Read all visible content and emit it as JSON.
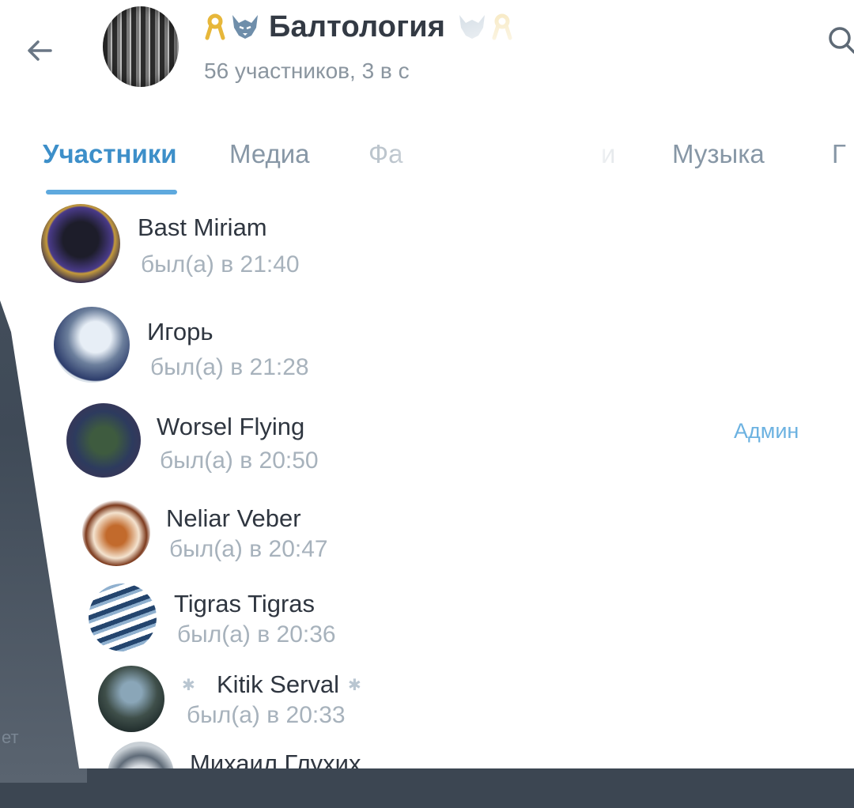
{
  "header": {
    "back_icon": "arrow-left-icon",
    "title": "Балтология",
    "title_prefix_icons": [
      "ribbon-icon",
      "wolf-icon"
    ],
    "title_suffix_icons": [
      "wolf-icon",
      "ribbon-icon"
    ],
    "subtitle": "56 участников, 3 в с",
    "search_icon": "search-icon"
  },
  "tabs": [
    {
      "label": "Участники",
      "active": true
    },
    {
      "label": "Медиа",
      "active": false
    },
    {
      "label": "Фа",
      "active": false
    },
    {
      "label": "и",
      "active": false
    },
    {
      "label": "Музыка",
      "active": false
    },
    {
      "label": "Г",
      "active": false
    }
  ],
  "members": [
    {
      "name": "Bast Miriam",
      "status": "был(а) в 21:40",
      "role": ""
    },
    {
      "name": "Игорь",
      "status": "был(а) в 21:28",
      "role": ""
    },
    {
      "name": "Worsel Flying",
      "status": "был(а) в 20:50",
      "role": "Админ"
    },
    {
      "name": "Neliar Veber",
      "status": "был(а) в 20:47",
      "role": ""
    },
    {
      "name": "Tigras Tigras",
      "status": "был(а) в 20:36",
      "role": ""
    },
    {
      "name": "Kitik Serval",
      "status": "был(а) в 20:33",
      "role": ""
    },
    {
      "name": "Михаил Глухих",
      "status": "",
      "role": ""
    }
  ],
  "background_fragments": [
    "ет"
  ],
  "colors": {
    "accent": "#3d8fc9",
    "tab_indicator": "#5ea9de",
    "admin_label": "#6cb2e1",
    "status_text": "#a7b2bc"
  }
}
